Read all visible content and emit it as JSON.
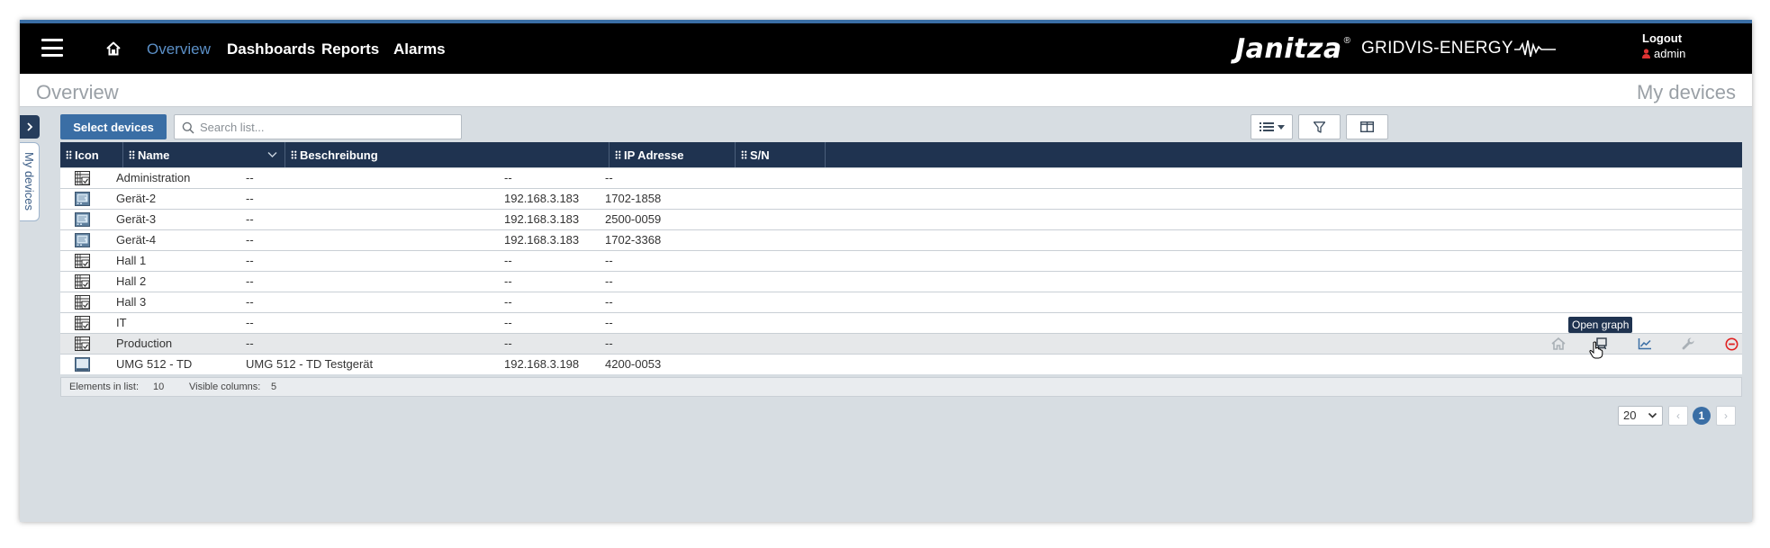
{
  "topbar": {
    "nav": [
      {
        "label": "Overview",
        "active": true
      },
      {
        "label": "Dashboards",
        "active": false
      },
      {
        "label": "Reports",
        "active": false
      },
      {
        "label": "Alarms",
        "active": false
      }
    ],
    "brand": {
      "name": "Janitza",
      "reg": "®",
      "product": "GRIDVIS-ENERGY"
    },
    "logout_label": "Logout",
    "user": "admin"
  },
  "titlebar": {
    "title": "Overview",
    "subtitle": "My devices"
  },
  "sidebar": {
    "tab_label": "My devices"
  },
  "toolbar": {
    "select_devices_label": "Select devices",
    "search_placeholder": "Search list..."
  },
  "table": {
    "columns": [
      "Icon",
      "Name",
      "Beschreibung",
      "IP Adresse",
      "S/N"
    ],
    "rows": [
      {
        "icon": "group-device-icon",
        "name": "Administration",
        "description": "--",
        "ip": "--",
        "sn": "--"
      },
      {
        "icon": "meter-device-icon",
        "name": "Gerät-2",
        "description": "--",
        "ip": "192.168.3.183",
        "sn": "1702-1858"
      },
      {
        "icon": "meter-device-icon",
        "name": "Gerät-3",
        "description": "--",
        "ip": "192.168.3.183",
        "sn": "2500-0059"
      },
      {
        "icon": "meter-device-icon",
        "name": "Gerät-4",
        "description": "--",
        "ip": "192.168.3.183",
        "sn": "1702-3368"
      },
      {
        "icon": "group-device-icon",
        "name": "Hall 1",
        "description": "--",
        "ip": "--",
        "sn": "--"
      },
      {
        "icon": "group-device-icon",
        "name": "Hall 2",
        "description": "--",
        "ip": "--",
        "sn": "--"
      },
      {
        "icon": "group-device-icon",
        "name": "Hall 3",
        "description": "--",
        "ip": "--",
        "sn": "--"
      },
      {
        "icon": "group-device-icon",
        "name": "IT",
        "description": "--",
        "ip": "--",
        "sn": "--"
      },
      {
        "icon": "group-device-icon",
        "name": "Production",
        "description": "--",
        "ip": "--",
        "sn": "--"
      },
      {
        "icon": "display-device-icon",
        "name": "UMG 512 - TD",
        "description": "UMG 512 - TD Testgerät",
        "ip": "192.168.3.198",
        "sn": "4200-0053"
      }
    ]
  },
  "tooltip": "Open graph",
  "footer": {
    "elements_label": "Elements in list:",
    "elements_count": "10",
    "columns_label": "Visible columns:",
    "columns_count": "5"
  },
  "pager": {
    "page_size": "20",
    "current_page": "1",
    "prev": "‹",
    "next": "›"
  },
  "colors": {
    "header": "#000000",
    "accent": "#3a6ea5",
    "grid_header": "#1f3350",
    "danger": "#e02020"
  }
}
